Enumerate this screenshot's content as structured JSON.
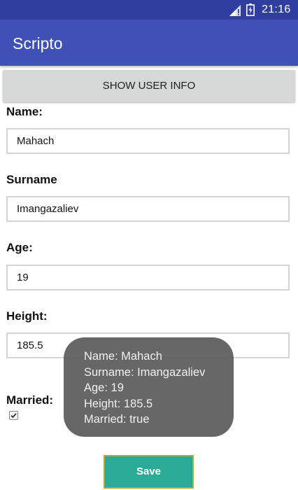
{
  "status_bar": {
    "time": "21:16",
    "icons": [
      "signal-icon",
      "battery-icon"
    ]
  },
  "app_bar": {
    "title": "Scripto"
  },
  "show_info_button": {
    "label": "SHOW USER INFO"
  },
  "form": {
    "name": {
      "label": "Name:",
      "value": "Mahach"
    },
    "surname": {
      "label": "Surname",
      "value": "Imangazaliev"
    },
    "age": {
      "label": "Age:",
      "value": "19"
    },
    "height": {
      "label": "Height:",
      "value": "185.5"
    },
    "married": {
      "label": "Married:",
      "checked": true
    }
  },
  "toast": {
    "lines": [
      "Name: Mahach",
      "Surname: Imangazaliev",
      "Age: 19",
      "Height: 185.5",
      "Married: true"
    ]
  },
  "save_button": {
    "label": "Save"
  },
  "colors": {
    "status_bar": "#303F9F",
    "app_bar": "#3F51B5",
    "save_button": "#2BAA98",
    "save_button_border": "#C9A227",
    "toast_background": "#5A5A5A"
  }
}
